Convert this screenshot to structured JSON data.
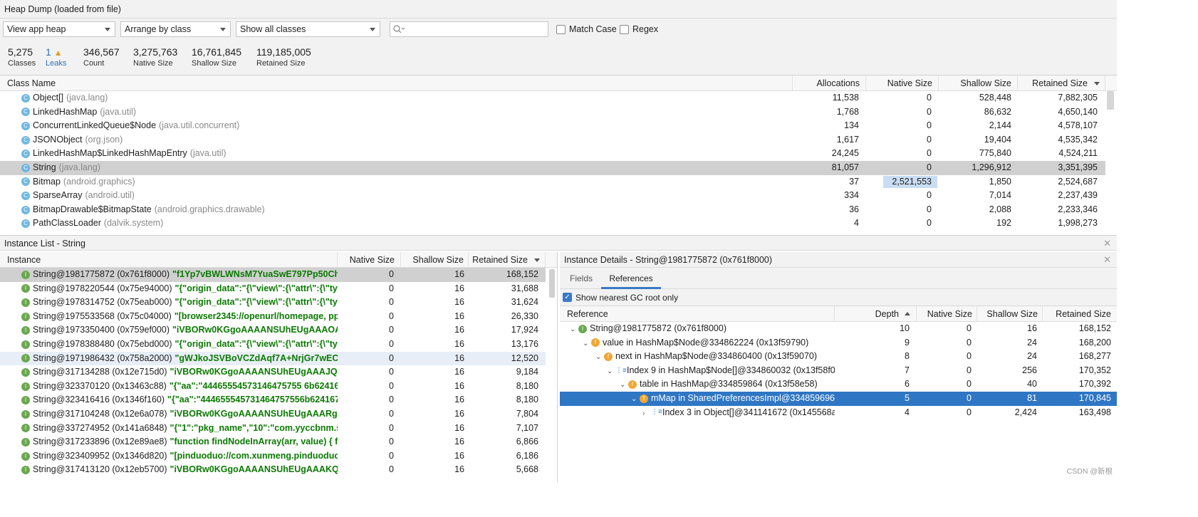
{
  "window": {
    "title": "Heap Dump (loaded from file)"
  },
  "toolbar": {
    "heap_select": "View app heap",
    "arrange_select": "Arrange by class",
    "filter_select": "Show all classes",
    "search_placeholder": "",
    "match_case": "Match Case",
    "regex": "Regex"
  },
  "stats": [
    {
      "value": "5,275",
      "label": "Classes"
    },
    {
      "value": "1",
      "label": "Leaks"
    },
    {
      "value": "346,567",
      "label": "Count"
    },
    {
      "value": "3,275,763",
      "label": "Native Size"
    },
    {
      "value": "16,761,845",
      "label": "Shallow Size"
    },
    {
      "value": "119,185,005",
      "label": "Retained Size"
    }
  ],
  "class_table": {
    "headers": {
      "name": "Class Name",
      "alloc": "Allocations",
      "native": "Native Size",
      "shallow": "Shallow Size",
      "retained": "Retained Size"
    },
    "rows": [
      {
        "name": "Object[]",
        "pkg": "(java.lang)",
        "alloc": "11,538",
        "native": "0",
        "shallow": "528,448",
        "retained": "7,882,305"
      },
      {
        "name": "LinkedHashMap",
        "pkg": "(java.util)",
        "alloc": "1,768",
        "native": "0",
        "shallow": "86,632",
        "retained": "4,650,140"
      },
      {
        "name": "ConcurrentLinkedQueue$Node",
        "pkg": "(java.util.concurrent)",
        "alloc": "134",
        "native": "0",
        "shallow": "2,144",
        "retained": "4,578,107"
      },
      {
        "name": "JSONObject",
        "pkg": "(org.json)",
        "alloc": "1,617",
        "native": "0",
        "shallow": "19,404",
        "retained": "4,535,342"
      },
      {
        "name": "LinkedHashMap$LinkedHashMapEntry",
        "pkg": "(java.util)",
        "alloc": "24,245",
        "native": "0",
        "shallow": "775,840",
        "retained": "4,524,211"
      },
      {
        "name": "String",
        "pkg": "(java.lang)",
        "alloc": "81,057",
        "native": "0",
        "shallow": "1,296,912",
        "retained": "3,351,395"
      },
      {
        "name": "Bitmap",
        "pkg": "(android.graphics)",
        "alloc": "37",
        "native": "2,521,553",
        "shallow": "1,850",
        "retained": "2,524,687"
      },
      {
        "name": "SparseArray",
        "pkg": "(android.util)",
        "alloc": "334",
        "native": "0",
        "shallow": "7,014",
        "retained": "2,237,439"
      },
      {
        "name": "BitmapDrawable$BitmapState",
        "pkg": "(android.graphics.drawable)",
        "alloc": "36",
        "native": "0",
        "shallow": "2,088",
        "retained": "2,233,346"
      },
      {
        "name": "PathClassLoader",
        "pkg": "(dalvik.system)",
        "alloc": "4",
        "native": "0",
        "shallow": "192",
        "retained": "1,998,273"
      }
    ]
  },
  "instance_list": {
    "title": "Instance List - String",
    "headers": {
      "instance": "Instance",
      "native": "Native Size",
      "shallow": "Shallow Size",
      "retained": "Retained Size"
    },
    "rows": [
      {
        "id": "String@1981775872 (0x761f8000)",
        "val": "\"f1Yp7vBWLWNsM7YuaSwE797Pp50Chj6tc",
        "native": "0",
        "shallow": "16",
        "retained": "168,152"
      },
      {
        "id": "String@1978220544 (0x75e94000)",
        "val": "\"{\"origin_data\":\"{\\\"view\\\":{\\\"attr\\\":{\\\"type",
        "native": "0",
        "shallow": "16",
        "retained": "31,688"
      },
      {
        "id": "String@1978314752 (0x75eab000)",
        "val": "\"{\"origin_data\":\"{\\\"view\\\":{\\\"attr\\\":{\\\"type",
        "native": "0",
        "shallow": "16",
        "retained": "31,624"
      },
      {
        "id": "String@1975533568 (0x75c04000)",
        "val": "\"[browser2345://openurl/homepage, ppdl",
        "native": "0",
        "shallow": "16",
        "retained": "26,330"
      },
      {
        "id": "String@1973350400 (0x759ef000)",
        "val": "\"iVBORw0KGgoAAAANSUhEUgAAAOAAAA",
        "native": "0",
        "shallow": "16",
        "retained": "17,924"
      },
      {
        "id": "String@1978388480 (0x75ebd000)",
        "val": "\"{\"origin_data\":\"{\\\"view\\\":{\\\"attr\\\":{\\\"type",
        "native": "0",
        "shallow": "16",
        "retained": "13,176"
      },
      {
        "id": "String@1971986432 (0x758a2000)",
        "val": "\"gWJkoJSVBoVCZdAqf7A+NrjGr7wECs7tw",
        "native": "0",
        "shallow": "16",
        "retained": "12,520"
      },
      {
        "id": "String@317134288 (0x12e715d0)",
        "val": "\"iVBORw0KGgoAAAANSUhEUgAAAJQAAA(",
        "native": "0",
        "shallow": "16",
        "retained": "9,184"
      },
      {
        "id": "String@323370120 (0x13463c88)",
        "val": "\"{\"aa\":\"44465554573146475755 6b624167464",
        "native": "0",
        "shallow": "16",
        "retained": "8,180"
      },
      {
        "id": "String@323416416 (0x1346f160)",
        "val": "\"{\"aa\":\"444655545731464757556b6241674643",
        "native": "0",
        "shallow": "16",
        "retained": "8,180"
      },
      {
        "id": "String@317104248 (0x12e6a078)",
        "val": "\"iVBORw0KGgoAAAANSUhEUgAAARgAAAE",
        "native": "0",
        "shallow": "16",
        "retained": "7,804"
      },
      {
        "id": "String@337274952 (0x141a6848)",
        "val": "\"{\"1\":\"pkg_name\",\"10\":\"com.yyccbnm.sgshg",
        "native": "0",
        "shallow": "16",
        "retained": "7,107"
      },
      {
        "id": "String@317233896 (0x12e89ae8)",
        "val": "\"function findNodeInArray(arr, value) {    fo",
        "native": "0",
        "shallow": "16",
        "retained": "6,866"
      },
      {
        "id": "String@323409952 (0x1346d820)",
        "val": "\"[pinduoduo://com.xunmeng.pinduoduo/r",
        "native": "0",
        "shallow": "16",
        "retained": "6,186"
      },
      {
        "id": "String@317413120 (0x12eb5700)",
        "val": "\"iVBORw0KGgoAAAANSUhEUgAAAKQAAAI",
        "native": "0",
        "shallow": "16",
        "retained": "5,668"
      }
    ]
  },
  "instance_details": {
    "title": "Instance Details - String@1981775872 (0x761f8000)",
    "tabs": [
      "Fields",
      "References"
    ],
    "show_gc": "Show nearest GC root only",
    "headers": {
      "ref": "Reference",
      "depth": "Depth",
      "native": "Native Size",
      "shallow": "Shallow Size",
      "retained": "Retained Size"
    },
    "rows": [
      {
        "text": "String@1981775872 (0x761f8000)",
        "depth": "10",
        "native": "0",
        "shallow": "16",
        "retained": "168,152"
      },
      {
        "text": "value in HashMap$Node@334862224 (0x13f59790)",
        "depth": "9",
        "native": "0",
        "shallow": "24",
        "retained": "168,200"
      },
      {
        "text": "next in HashMap$Node@334860400 (0x13f59070)",
        "depth": "8",
        "native": "0",
        "shallow": "24",
        "retained": "168,277"
      },
      {
        "text": "Index 9 in HashMap$Node[]@334860032 (0x13f58f00",
        "depth": "7",
        "native": "0",
        "shallow": "256",
        "retained": "170,352"
      },
      {
        "text": "table in HashMap@334859864 (0x13f58e58)",
        "depth": "6",
        "native": "0",
        "shallow": "40",
        "retained": "170,392"
      },
      {
        "text": "mMap in SharedPreferencesImpl@334859696 (",
        "depth": "5",
        "native": "0",
        "shallow": "81",
        "retained": "170,845"
      },
      {
        "text": "Index 3 in Object[]@341141672 (0x145568a8",
        "depth": "4",
        "native": "0",
        "shallow": "2,424",
        "retained": "163,498"
      }
    ]
  },
  "watermark": "CSDN @新根"
}
